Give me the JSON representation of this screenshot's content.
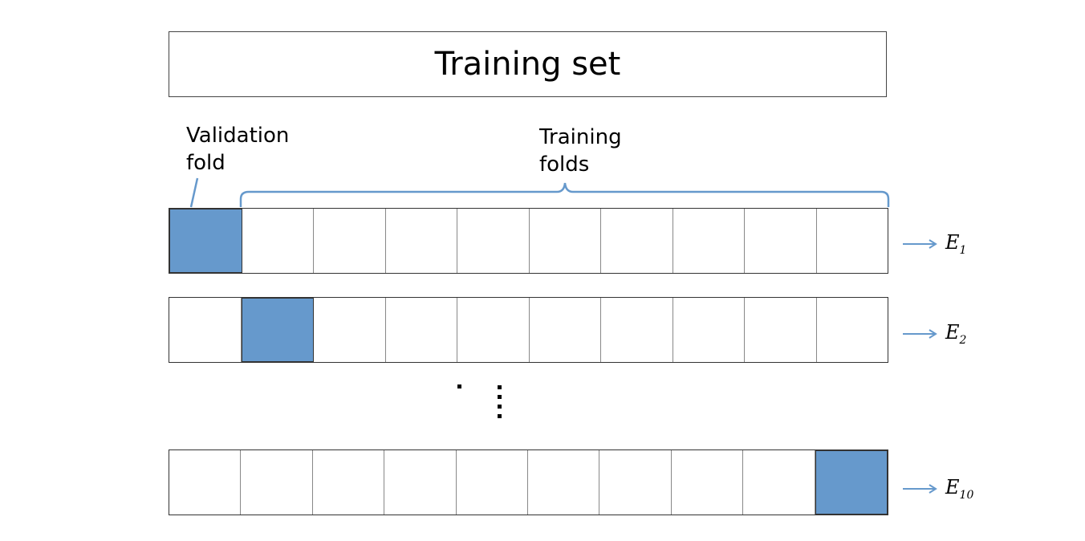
{
  "title": "Training set",
  "labels": {
    "validation_line1": "Validation",
    "validation_line2": "fold",
    "training_line1": "Training",
    "training_line2": "folds"
  },
  "folds_per_row": 10,
  "rows": [
    {
      "validation_index": 0,
      "result_base": "E",
      "result_sub": "1"
    },
    {
      "validation_index": 1,
      "result_base": "E",
      "result_sub": "2"
    },
    {
      "validation_index": 9,
      "result_base": "E",
      "result_sub": "10"
    }
  ],
  "colors": {
    "validation_fill": "#6699cc",
    "accent_line": "#6699cc",
    "border": "#333333"
  }
}
